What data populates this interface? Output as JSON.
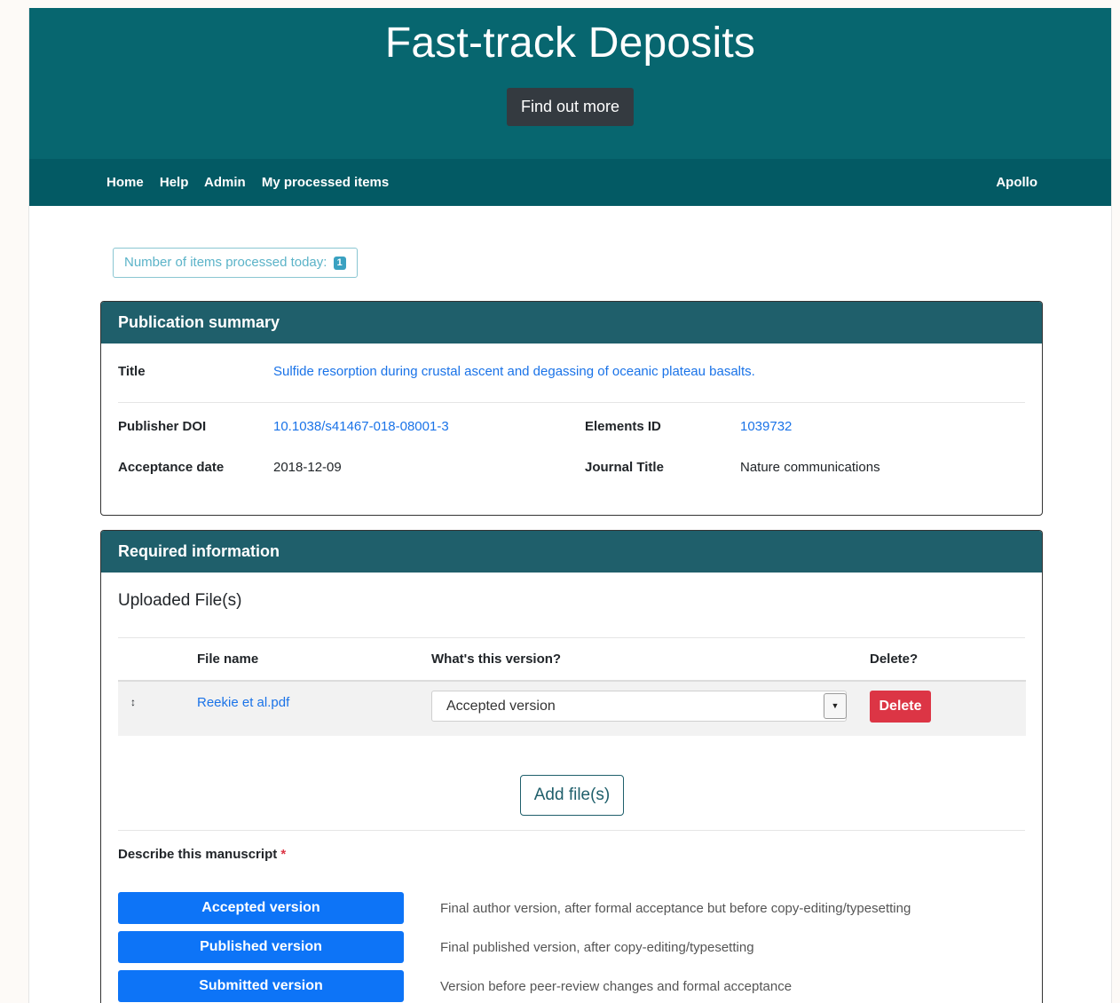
{
  "hero": {
    "title": "Fast-track Deposits",
    "button": "Find out more"
  },
  "nav": {
    "links": [
      "Home",
      "Help",
      "Admin",
      "My processed items"
    ],
    "user": "Apollo"
  },
  "counter": {
    "label": "Number of items processed today:",
    "count": "1"
  },
  "summary": {
    "header": "Publication summary",
    "title_label": "Title",
    "title_value": "Sulfide resorption during crustal ascent and degassing of oceanic plateau basalts.",
    "doi_label": "Publisher DOI",
    "doi_value": "10.1038/s41467-018-08001-3",
    "elements_label": "Elements ID",
    "elements_value": "1039732",
    "acceptance_label": "Acceptance date",
    "acceptance_value": "2018-12-09",
    "journal_label": "Journal Title",
    "journal_value": "Nature communications"
  },
  "required": {
    "header": "Required information",
    "uploaded_title": "Uploaded File(s)",
    "columns": {
      "file_name": "File name",
      "version": "What's this version?",
      "delete": "Delete?"
    },
    "file": {
      "drag_handle": "↕",
      "name": "Reekie et al.pdf",
      "version": "Accepted version",
      "delete_label": "Delete"
    },
    "add_files": "Add file(s)",
    "describe_label": "Describe this manuscript",
    "required_mark": "*",
    "versions": [
      {
        "label": "Accepted version",
        "desc": "Final author version, after formal acceptance but before copy-editing/typesetting"
      },
      {
        "label": "Published version",
        "desc": "Final published version, after copy-editing/typesetting"
      },
      {
        "label": "Submitted version",
        "desc": "Version before peer-review changes and formal acceptance"
      }
    ]
  }
}
